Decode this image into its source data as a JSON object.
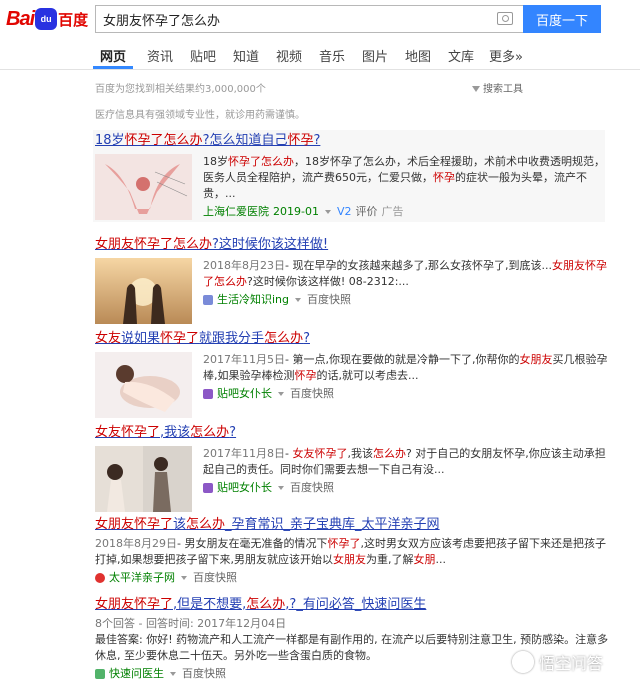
{
  "header": {
    "logo_bai": "Bai",
    "logo_du": "du",
    "logo_name": "百度",
    "query": "女朋友怀孕了怎么办",
    "search_button": "百度一下"
  },
  "tabs": [
    "网页",
    "资讯",
    "贴吧",
    "知道",
    "视频",
    "音乐",
    "图片",
    "地图",
    "文库",
    "更多»"
  ],
  "meta": {
    "result_count": "百度为您找到相关结果约3,000,000个",
    "tools": "搜索工具",
    "notice": "医疗信息具有强领域专业性，就诊用药需谨慎。"
  },
  "results": [
    {
      "title_parts": [
        [
          "18岁",
          0
        ],
        [
          "怀孕了怎么办",
          1
        ],
        [
          "?怎么知道自己",
          0
        ],
        [
          "怀孕",
          1
        ],
        [
          "?",
          0
        ]
      ],
      "body_parts": [
        [
          "18岁",
          0
        ],
        [
          "怀孕了怎么办",
          1
        ],
        [
          "，18岁怀孕了怎么办，术后全程援助，术前术中收费透明规范，医务人员全程陪护，流产费650元，仁爱只做，",
          0
        ],
        [
          "怀孕",
          1
        ],
        [
          "的症状一般为头晕，流产不贵，...",
          0
        ]
      ],
      "source": "上海仁爱医院",
      "date": "2019-01",
      "v_label": "V2",
      "extra1": "评价",
      "extra2": "广告"
    },
    {
      "title_parts": [
        [
          "女朋友怀孕了怎么办",
          1
        ],
        [
          "?这时候你该这样做!",
          0
        ]
      ],
      "date": "2018年8月23日",
      "body_parts": [
        [
          "- 现在早孕的女孩越来越多了,那么女孩怀孕了,到底该...",
          0
        ],
        [
          "女朋友怀孕了怎么办",
          1
        ],
        [
          "?这时候你该这样做! 08-2312:...",
          0
        ]
      ],
      "source": "生活冷知识ing",
      "snapshot": "百度快照"
    },
    {
      "title_parts": [
        [
          "女友",
          1
        ],
        [
          "说如果",
          0
        ],
        [
          "怀孕了",
          1
        ],
        [
          "就跟我分手",
          0
        ],
        [
          "怎么办",
          1
        ],
        [
          "?",
          0
        ]
      ],
      "date": "2017年11月5日",
      "body_parts": [
        [
          "- 第一点,你现在要做的就是冷静一下了,你帮你的",
          0
        ],
        [
          "女朋友",
          1
        ],
        [
          "买几根验孕棒,如果验孕棒检测",
          0
        ],
        [
          "怀孕",
          1
        ],
        [
          "的话,就可以考虑去...",
          0
        ]
      ],
      "source": "贴吧女仆长",
      "snapshot": "百度快照"
    },
    {
      "title_parts": [
        [
          "女友怀孕了",
          1
        ],
        [
          ",我该",
          0
        ],
        [
          "怎么办",
          1
        ],
        [
          "?",
          0
        ]
      ],
      "date": "2017年11月8日",
      "body_parts": [
        [
          "- ",
          0
        ],
        [
          "女友怀孕了",
          1
        ],
        [
          ",我该",
          0
        ],
        [
          "怎么办",
          1
        ],
        [
          "? 对于自己的女朋友怀孕,你应该主动承担起自己的责任。同时你们需要去想一下自己有没...",
          0
        ]
      ],
      "source": "贴吧女仆长",
      "snapshot": "百度快照"
    },
    {
      "title_parts": [
        [
          "女朋友怀孕了",
          1
        ],
        [
          "该",
          0
        ],
        [
          "怎么办",
          1
        ],
        [
          "_孕育常识_亲子宝典库_太平洋亲子网",
          0
        ]
      ],
      "date": "2018年8月29日",
      "body_parts": [
        [
          "- 男女朋友在毫无准备的情况下",
          0
        ],
        [
          "怀孕了",
          1
        ],
        [
          ",这时男女双方应该考虑要把孩子留下来还是把孩子打掉,如果想要把孩子留下来,男朋友就应该开始以",
          0
        ],
        [
          "女朋友",
          1
        ],
        [
          "为重,了解",
          0
        ],
        [
          "女朋",
          1
        ],
        [
          "...",
          0
        ]
      ],
      "source": "太平洋亲子网",
      "snapshot": "百度快照"
    },
    {
      "title_parts": [
        [
          "女朋友怀孕了",
          1
        ],
        [
          ",但是不想要,",
          0
        ],
        [
          "怎么办",
          1
        ],
        [
          ",?_有问必答_快速问医生",
          0
        ]
      ],
      "answers": "8个回答 - 回答时间: 2017年12月04日",
      "body_parts": [
        [
          "最佳答案: 你好! 药物流产和人工流产一样都是有副作用的, 在流产以后要特别注意卫生, 预防感染。注意多休息, 至少要休息二十伍天。另外吃一些含蛋白质的食物。",
          0
        ]
      ],
      "source": "快速问医生",
      "snapshot": "百度快照"
    }
  ],
  "watermark": "悟空问答",
  "colors": {
    "link": "#2440b3",
    "highlight": "#cc0000",
    "source": "#008000",
    "button": "#3385ff"
  }
}
